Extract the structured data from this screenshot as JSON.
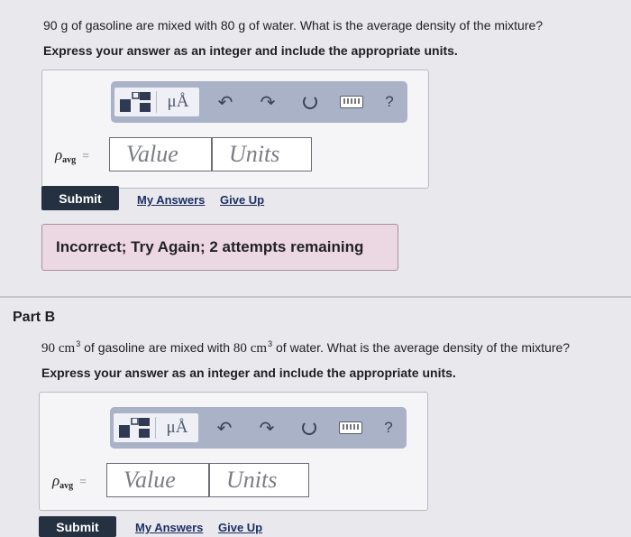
{
  "part_a": {
    "question_pre": "90 g of gasoline are mixed with 80  g of water. What is the average density of the mixture?",
    "instruction": "Express your answer as an integer and include the appropriate units.",
    "variable_symbol": "ρ",
    "variable_subscript": "avg",
    "equals": "=",
    "value_placeholder": "Value",
    "units_placeholder": "Units",
    "submit_label": "Submit",
    "my_answers_label": "My Answers",
    "give_up_label": "Give Up",
    "feedback": "Incorrect; Try Again; 2 attempts remaining"
  },
  "part_b": {
    "heading": "Part B",
    "q_num1": "90",
    "q_unit1": "cm",
    "q_exp1": "3",
    "q_mid": " of gasoline are mixed with ",
    "q_num2": "80",
    "q_unit2": "cm",
    "q_exp2": "3",
    "q_end": " of water. What is the average density of the mixture?",
    "instruction": "Express your answer as an integer and include the appropriate units.",
    "variable_symbol": "ρ",
    "variable_subscript": "avg",
    "equals": "=",
    "value_placeholder": "Value",
    "units_placeholder": "Units",
    "submit_label": "Submit",
    "my_answers_label": "My Answers",
    "give_up_label": "Give Up"
  },
  "toolbar": {
    "units_button": "μÅ",
    "help": "?"
  },
  "icons": [
    "templates-icon",
    "units-icon",
    "undo-icon",
    "redo-icon",
    "reset-icon",
    "keyboard-icon",
    "help-icon"
  ]
}
